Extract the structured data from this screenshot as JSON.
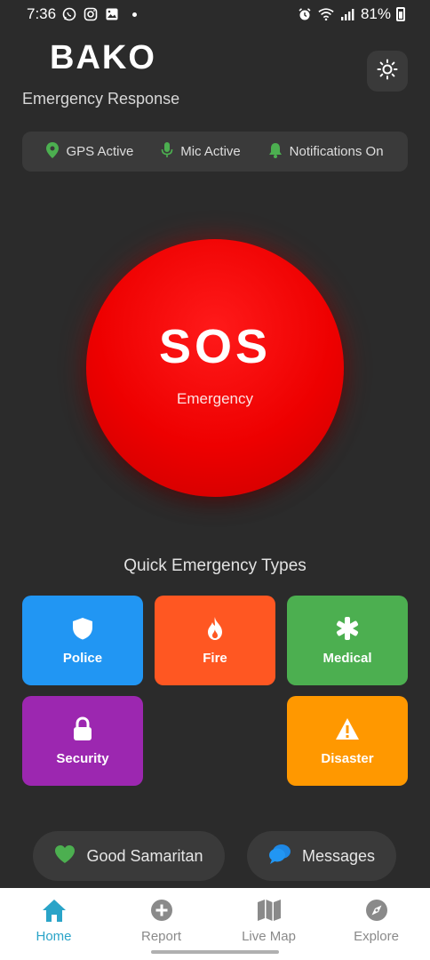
{
  "status_bar": {
    "time": "7:36",
    "battery": "81%",
    "icons": [
      "whatsapp-icon",
      "instagram-icon",
      "gallery-icon",
      "alarm-icon",
      "wifi-icon",
      "signal-icon",
      "battery-icon"
    ]
  },
  "header": {
    "title": "BAKO",
    "subtitle": "Emergency Response",
    "theme_icon": "sun-icon"
  },
  "status_chips": [
    {
      "label": "GPS Active",
      "icon": "location-pin-icon",
      "color": "#4caf50"
    },
    {
      "label": "Mic Active",
      "icon": "microphone-icon",
      "color": "#4caf50"
    },
    {
      "label": "Notifications On",
      "icon": "bell-icon",
      "color": "#4caf50"
    }
  ],
  "sos": {
    "label": "SOS",
    "sublabel": "Emergency",
    "color": "#ee0000"
  },
  "quick_types": {
    "title": "Quick Emergency Types",
    "items": [
      {
        "label": "Police",
        "icon": "shield-icon",
        "color": "#2196f3"
      },
      {
        "label": "Fire",
        "icon": "flame-icon",
        "color": "#ff5722"
      },
      {
        "label": "Medical",
        "icon": "asterisk-icon",
        "color": "#4caf50"
      },
      {
        "label": "Security",
        "icon": "lock-icon",
        "color": "#9c27b0"
      },
      {
        "label": "Disaster",
        "icon": "warning-icon",
        "color": "#ff9800"
      }
    ]
  },
  "actions": [
    {
      "label": "Good Samaritan",
      "icon": "heart-icon",
      "color": "#4caf50"
    },
    {
      "label": "Messages",
      "icon": "chat-bubbles-icon",
      "color": "#2196f3"
    }
  ],
  "nav": {
    "items": [
      {
        "label": "Home",
        "icon": "home-icon",
        "active": true
      },
      {
        "label": "Report",
        "icon": "plus-circle-icon",
        "active": false
      },
      {
        "label": "Live Map",
        "icon": "map-icon",
        "active": false
      },
      {
        "label": "Explore",
        "icon": "compass-icon",
        "active": false
      }
    ],
    "active_color": "#2aa4c8"
  }
}
